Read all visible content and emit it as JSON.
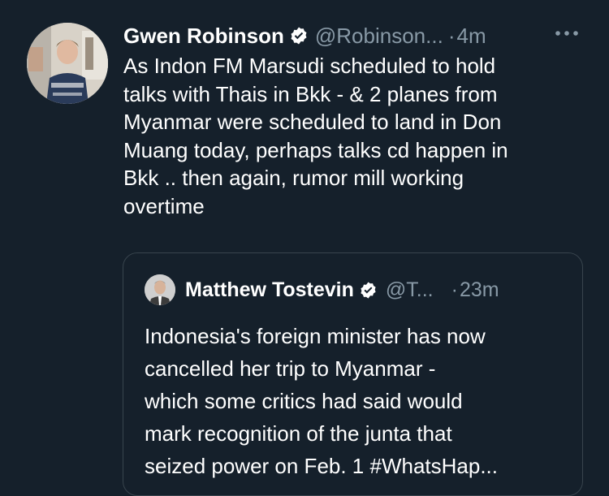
{
  "tweet": {
    "author_name": "Gwen Robinson",
    "handle": "@Robinson...",
    "separator": "·",
    "time": "4m",
    "more_icon": "more-horizontal-icon",
    "verified_icon": "verified-badge-icon",
    "text": "As Indon FM Marsudi scheduled to hold\ntalks with Thais in Bkk - & 2 planes from\nMyanmar were scheduled to land in Don\nMuang today, perhaps talks cd happen in\nBkk .. then again,  rumor mill working\novertime"
  },
  "quoted_tweet": {
    "author_name": "Matthew Tostevin",
    "handle": "@T...",
    "separator": "·",
    "time": "23m",
    "verified_icon": "verified-badge-icon",
    "text": "Indonesia's foreign minister has now\ncancelled her trip to Myanmar -\nwhich some critics had said would\nmark recognition of the junta that\nseized power on Feb. 1 #WhatsHap..."
  },
  "colors": {
    "background": "#15202b",
    "primary_text": "#ffffff",
    "secondary_text": "#8899a6",
    "border": "#38444d"
  }
}
